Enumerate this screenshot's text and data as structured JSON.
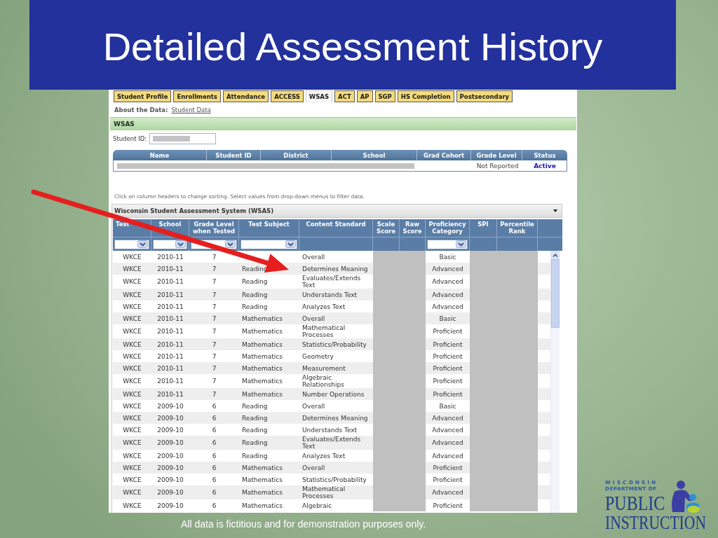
{
  "title": "Detailed Assessment History",
  "tabs": [
    {
      "label": "Student Profile",
      "selected": false
    },
    {
      "label": "Enrollments",
      "selected": false
    },
    {
      "label": "Attendance",
      "selected": false
    },
    {
      "label": "ACCESS",
      "selected": false
    },
    {
      "label": "WSAS",
      "selected": true
    },
    {
      "label": "ACT",
      "selected": false
    },
    {
      "label": "AP",
      "selected": false
    },
    {
      "label": "SGP",
      "selected": false
    },
    {
      "label": "HS Completion",
      "selected": false
    },
    {
      "label": "Postsecondary",
      "selected": false
    }
  ],
  "about": {
    "label": "About the Data:",
    "link": "Student Data"
  },
  "section_title": "WSAS",
  "student_id": {
    "label": "Student ID:",
    "redacted": true
  },
  "student_table": {
    "columns": [
      "Name",
      "Student ID",
      "District",
      "School",
      "Grad Cohort",
      "Grade Level",
      "Status"
    ],
    "row": {
      "redacted": true,
      "grade_level": "Not Reported",
      "status": "Active"
    }
  },
  "instructions": "Click on column headers to change sorting. Select values from drop-down menus to filter data.",
  "grid": {
    "title": "Wisconsin Student Assessment System (WSAS)",
    "columns": [
      {
        "label": "Test",
        "filter": true,
        "redacted": false
      },
      {
        "label": "School",
        "filter": true,
        "redacted": false
      },
      {
        "label": "Grade Level when Tested",
        "filter": true,
        "redacted": false
      },
      {
        "label": "Test Subject",
        "filter": true,
        "redacted": false
      },
      {
        "label": "Content Standard",
        "filter": false,
        "redacted": false
      },
      {
        "label": "Scale Score",
        "filter": false,
        "redacted": true
      },
      {
        "label": "Raw Score",
        "filter": false,
        "redacted": true
      },
      {
        "label": "Proficiency Category",
        "filter": true,
        "redacted": false
      },
      {
        "label": "SPI",
        "filter": false,
        "redacted": true
      },
      {
        "label": "Percentile Rank",
        "filter": false,
        "redacted": true
      }
    ],
    "rows": [
      {
        "cells": [
          "WKCE",
          "2010-11",
          "7",
          null,
          "Overall",
          "Basic"
        ]
      },
      {
        "cells": [
          "WKCE",
          "2010-11",
          "7",
          "Reading",
          "Determines Meaning",
          "Advanced"
        ]
      },
      {
        "cells": [
          "WKCE",
          "2010-11",
          "7",
          "Reading",
          "Evaluates/Extends Text",
          "Advanced"
        ]
      },
      {
        "cells": [
          "WKCE",
          "2010-11",
          "7",
          "Reading",
          "Understands Text",
          "Advanced"
        ]
      },
      {
        "cells": [
          "WKCE",
          "2010-11",
          "7",
          "Reading",
          "Analyzes Text",
          "Advanced"
        ]
      },
      {
        "cells": [
          "WKCE",
          "2010-11",
          "7",
          "Mathematics",
          "Overall",
          "Basic"
        ]
      },
      {
        "cells": [
          "WKCE",
          "2010-11",
          "7",
          "Mathematics",
          "Mathematical Processes",
          "Proficient"
        ]
      },
      {
        "cells": [
          "WKCE",
          "2010-11",
          "7",
          "Mathematics",
          "Statistics/Probability",
          "Proficient"
        ]
      },
      {
        "cells": [
          "WKCE",
          "2010-11",
          "7",
          "Mathematics",
          "Geometry",
          "Proficient"
        ]
      },
      {
        "cells": [
          "WKCE",
          "2010-11",
          "7",
          "Mathematics",
          "Measurement",
          "Proficient"
        ]
      },
      {
        "cells": [
          "WKCE",
          "2010-11",
          "7",
          "Mathematics",
          "Algebraic Relationships",
          "Proficient"
        ]
      },
      {
        "cells": [
          "WKCE",
          "2010-11",
          "7",
          "Mathematics",
          "Number Operations",
          "Proficient"
        ]
      },
      {
        "cells": [
          "WKCE",
          "2009-10",
          "6",
          "Reading",
          "Overall",
          "Basic"
        ]
      },
      {
        "cells": [
          "WKCE",
          "2009-10",
          "6",
          "Reading",
          "Determines Meaning",
          "Advanced"
        ]
      },
      {
        "cells": [
          "WKCE",
          "2009-10",
          "6",
          "Reading",
          "Understands Text",
          "Advanced"
        ]
      },
      {
        "cells": [
          "WKCE",
          "2009-10",
          "6",
          "Reading",
          "Evaluates/Extends Text",
          "Advanced"
        ]
      },
      {
        "cells": [
          "WKCE",
          "2009-10",
          "6",
          "Reading",
          "Analyzes Text",
          "Advanced"
        ]
      },
      {
        "cells": [
          "WKCE",
          "2009-10",
          "6",
          "Mathematics",
          "Overall",
          "Proficient"
        ]
      },
      {
        "cells": [
          "WKCE",
          "2009-10",
          "6",
          "Mathematics",
          "Statistics/Probability",
          "Proficient"
        ]
      },
      {
        "cells": [
          "WKCE",
          "2009-10",
          "6",
          "Mathematics",
          "Mathematical Processes",
          "Advanced"
        ]
      },
      {
        "cells": [
          "WKCE",
          "2009-10",
          "6",
          "Mathematics",
          "Algebraic",
          "Proficient"
        ]
      }
    ]
  },
  "caption": "All data is fictitious and for demonstration purposes only.",
  "logo": {
    "lines": [
      "WISCONSIN",
      "DEPARTMENT OF",
      "PUBLIC",
      "INSTRUCTION"
    ]
  }
}
